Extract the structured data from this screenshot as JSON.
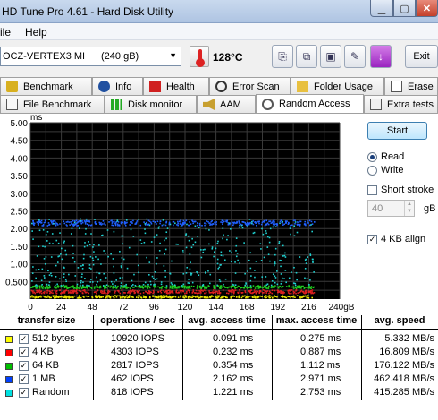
{
  "window": {
    "title": "HD Tune Pro 4.61 - Hard Disk Utility"
  },
  "menu": {
    "file": "ile",
    "help": "Help"
  },
  "toolbar": {
    "drive_name": "OCZ-VERTEX3 MI",
    "drive_capacity": "(240 gB)",
    "temperature": "128°C",
    "exit_label": "Exit"
  },
  "tabs_row1": [
    "Benchmark",
    "Info",
    "Health",
    "Error Scan",
    "Folder Usage",
    "Erase"
  ],
  "tabs_row2": [
    "File Benchmark",
    "Disk monitor",
    "AAM",
    "Random Access",
    "Extra tests"
  ],
  "active_tab": "Random Access",
  "controls": {
    "start_label": "Start",
    "read_label": "Read",
    "write_label": "Write",
    "read_selected": true,
    "short_stroke_label": "Short stroke",
    "short_stroke_checked": false,
    "short_stroke_value": "40",
    "short_stroke_unit": "gB",
    "align_label": "4 KB align",
    "align_checked": true
  },
  "chart_data": {
    "type": "scatter",
    "ylabel": "ms",
    "xlabel": "",
    "ylim": [
      0,
      5
    ],
    "xlim": [
      0,
      240
    ],
    "y_ticks": [
      "5.00",
      "4.50",
      "4.00",
      "3.50",
      "3.00",
      "2.50",
      "2.00",
      "1.50",
      "1.00",
      "0.500"
    ],
    "x_ticks": [
      "0",
      "24",
      "48",
      "72",
      "96",
      "120",
      "144",
      "168",
      "192",
      "216",
      "240gB"
    ],
    "grid": true,
    "series": [
      {
        "name": "512 bytes",
        "color": "#e8e800",
        "band": [
          0.05,
          0.12
        ]
      },
      {
        "name": "4 KB",
        "color": "#e02020",
        "band": [
          0.18,
          0.28
        ]
      },
      {
        "name": "64 KB",
        "color": "#20d020",
        "band": [
          0.32,
          0.4
        ]
      },
      {
        "name": "1 MB",
        "color": "#2060ff",
        "band": [
          2.1,
          2.25
        ]
      },
      {
        "name": "Random",
        "color": "#20d0d0",
        "band": [
          0.4,
          2.75
        ]
      }
    ]
  },
  "table": {
    "headers": [
      "transfer size",
      "operations / sec",
      "avg. access time",
      "max. access time",
      "avg. speed"
    ],
    "rows": [
      {
        "color": "#ffff00",
        "size": "512 bytes",
        "ops": "10920 IOPS",
        "avg": "0.091 ms",
        "max": "0.275 ms",
        "speed": "5.332 MB/s"
      },
      {
        "color": "#ff0000",
        "size": "4 KB",
        "ops": "4303 IOPS",
        "avg": "0.232 ms",
        "max": "0.887 ms",
        "speed": "16.809 MB/s"
      },
      {
        "color": "#00c000",
        "size": "64 KB",
        "ops": "2817 IOPS",
        "avg": "0.354 ms",
        "max": "1.112 ms",
        "speed": "176.122 MB/s"
      },
      {
        "color": "#0040ff",
        "size": "1 MB",
        "ops": "462 IOPS",
        "avg": "2.162 ms",
        "max": "2.971 ms",
        "speed": "462.418 MB/s"
      },
      {
        "color": "#00e0e0",
        "size": "Random",
        "ops": "818 IOPS",
        "avg": "1.221 ms",
        "max": "2.753 ms",
        "speed": "415.285 MB/s"
      }
    ]
  }
}
